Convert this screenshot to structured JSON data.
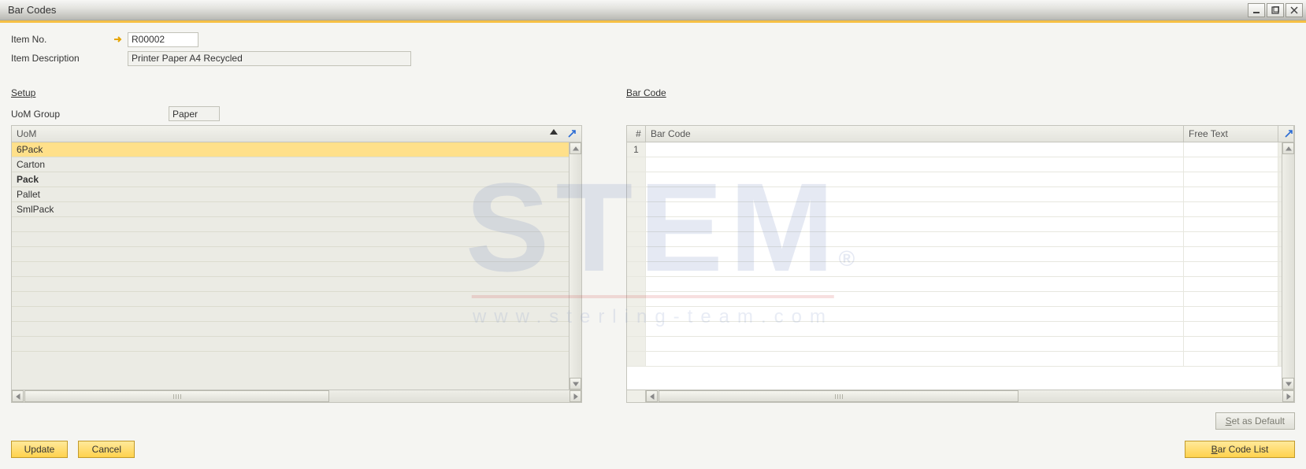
{
  "window": {
    "title": "Bar Codes"
  },
  "header": {
    "item_no_label": "Item No.",
    "item_no_value": "R00002",
    "item_desc_label": "Item Description",
    "item_desc_value": "Printer Paper A4 Recycled"
  },
  "setup": {
    "title": "Setup",
    "uom_group_label": "UoM Group",
    "uom_group_value": "Paper",
    "uom_column": "UoM",
    "rows": [
      {
        "label": "6Pack",
        "selected": true,
        "bold": false
      },
      {
        "label": "Carton",
        "selected": false,
        "bold": false
      },
      {
        "label": "Pack",
        "selected": false,
        "bold": true
      },
      {
        "label": "Pallet",
        "selected": false,
        "bold": false
      },
      {
        "label": "SmlPack",
        "selected": false,
        "bold": false
      }
    ]
  },
  "barcode": {
    "title": "Bar Code",
    "col_num": "#",
    "col_code": "Bar Code",
    "col_free": "Free Text",
    "rows": [
      {
        "num": "1",
        "code": "",
        "free": ""
      }
    ]
  },
  "buttons": {
    "update": "Update",
    "cancel": "Cancel",
    "set_default_pre": "S",
    "set_default_rest": "et as Default",
    "barcode_list_pre": "B",
    "barcode_list_rest": "ar Code List"
  },
  "watermark": {
    "text": "STEM",
    "url": "www.sterling-team.com"
  }
}
